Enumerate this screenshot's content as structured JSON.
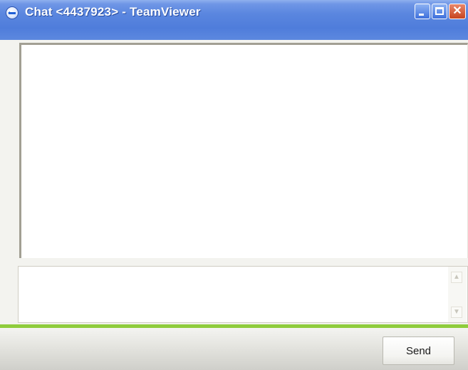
{
  "window": {
    "title": "Chat <4437923> - TeamViewer",
    "app_icon": "teamviewer-icon",
    "controls": {
      "minimize_icon": "minimize-icon",
      "maximize_icon": "maximize-icon",
      "close_glyph": "✕"
    }
  },
  "chat": {
    "log_text": "",
    "input_value": "",
    "scroll_up_glyph": "▲",
    "scroll_down_glyph": "▼"
  },
  "footer": {
    "send_label": "Send"
  },
  "colors": {
    "titlebar": "#5a86df",
    "accent_divider": "#8fcc3c",
    "close_button": "#c7441f"
  }
}
